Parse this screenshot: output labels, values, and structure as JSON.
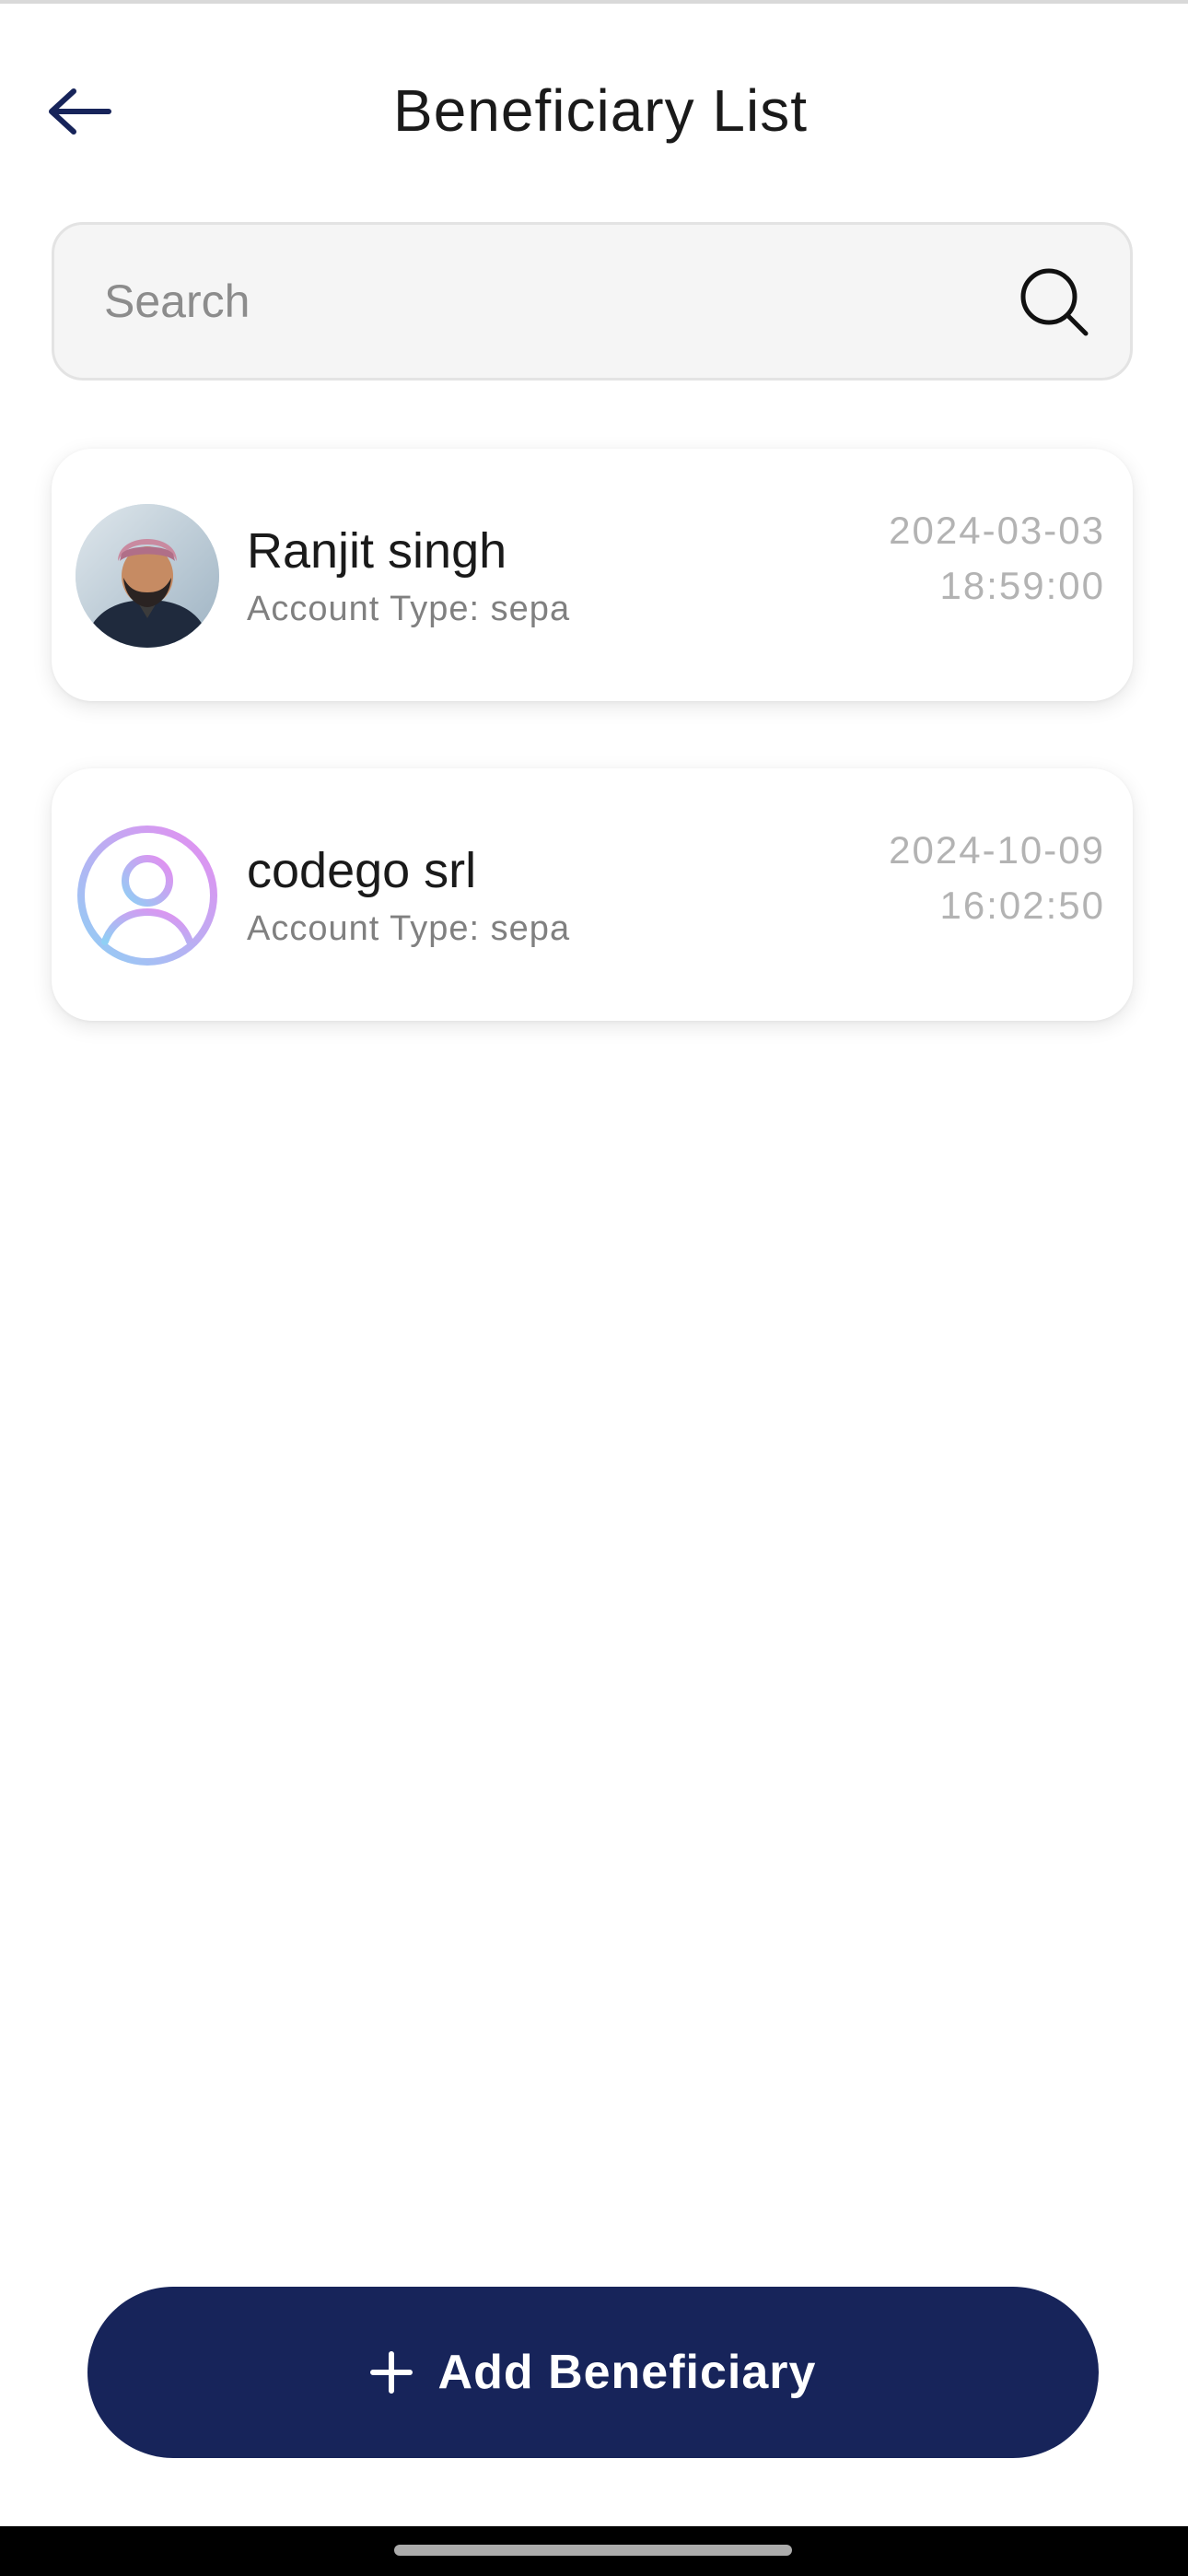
{
  "header": {
    "title": "Beneficiary List",
    "back_icon": "arrow-left-icon"
  },
  "search": {
    "placeholder": "Search",
    "value": "",
    "icon": "search-icon"
  },
  "beneficiaries": [
    {
      "name": "Ranjit singh",
      "account_type": "Account Type: sepa",
      "date": "2024-03-03",
      "time": "18:59:00",
      "avatar": "user-photo"
    },
    {
      "name": "codego srl",
      "account_type": "Account Type: sepa",
      "date": "2024-10-09",
      "time": "16:02:50",
      "avatar": "user-placeholder-icon"
    }
  ],
  "add_button": {
    "label": "Add Beneficiary",
    "icon": "plus-icon"
  },
  "colors": {
    "primary": "#17245a",
    "text": "#1a1a1a",
    "muted": "#808080",
    "timestamp": "#b3b3b3",
    "search_bg": "#f5f5f5",
    "avatar_gradient_start": "#8fd0f5",
    "avatar_gradient_end": "#e78cf0"
  }
}
